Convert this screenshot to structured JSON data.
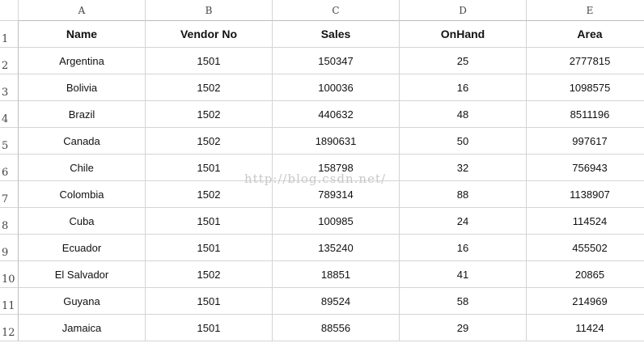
{
  "column_headers": [
    "A",
    "B",
    "C",
    "D",
    "E"
  ],
  "row_numbers": [
    "1",
    "2",
    "3",
    "4",
    "5",
    "6",
    "7",
    "8",
    "9",
    "10",
    "11",
    "12"
  ],
  "table": {
    "headers": [
      "Name",
      "Vendor No",
      "Sales",
      "OnHand",
      "Area"
    ],
    "rows": [
      [
        "Argentina",
        "1501",
        "150347",
        "25",
        "2777815"
      ],
      [
        "Bolivia",
        "1502",
        "100036",
        "16",
        "1098575"
      ],
      [
        "Brazil",
        "1502",
        "440632",
        "48",
        "8511196"
      ],
      [
        "Canada",
        "1502",
        "1890631",
        "50",
        "997617"
      ],
      [
        "Chile",
        "1501",
        "158798",
        "32",
        "756943"
      ],
      [
        "Colombia",
        "1502",
        "789314",
        "88",
        "1138907"
      ],
      [
        "Cuba",
        "1501",
        "100985",
        "24",
        "114524"
      ],
      [
        "Ecuador",
        "1501",
        "135240",
        "16",
        "455502"
      ],
      [
        "El Salvador",
        "1502",
        "18851",
        "41",
        "20865"
      ],
      [
        "Guyana",
        "1501",
        "89524",
        "58",
        "214969"
      ],
      [
        "Jamaica",
        "1501",
        "88556",
        "29",
        "11424"
      ]
    ]
  },
  "watermark": "http://blog.csdn.net/"
}
